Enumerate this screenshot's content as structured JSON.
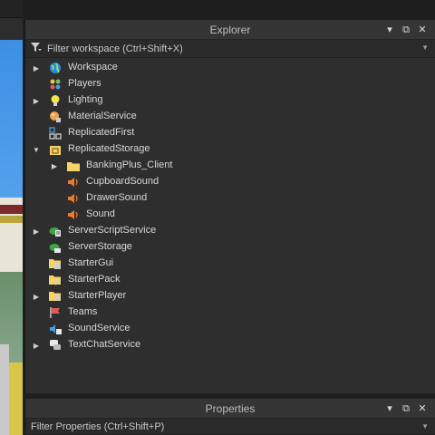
{
  "explorer": {
    "title": "Explorer",
    "filter_placeholder": "Filter workspace (Ctrl+Shift+X)",
    "items": [
      {
        "label": "Workspace",
        "level": 0,
        "arrow": "right",
        "icon": "globe-icon"
      },
      {
        "label": "Players",
        "level": 0,
        "arrow": "",
        "icon": "players-icon"
      },
      {
        "label": "Lighting",
        "level": 0,
        "arrow": "right",
        "icon": "lightbulb-icon"
      },
      {
        "label": "MaterialService",
        "level": 0,
        "arrow": "",
        "icon": "material-icon"
      },
      {
        "label": "ReplicatedFirst",
        "level": 0,
        "arrow": "",
        "icon": "replicated-first-icon"
      },
      {
        "label": "ReplicatedStorage",
        "level": 0,
        "arrow": "down",
        "icon": "replicated-storage-icon"
      },
      {
        "label": "BankingPlus_Client",
        "level": 1,
        "arrow": "right",
        "icon": "folder-icon"
      },
      {
        "label": "CupboardSound",
        "level": 1,
        "arrow": "",
        "icon": "speaker-icon"
      },
      {
        "label": "DrawerSound",
        "level": 1,
        "arrow": "",
        "icon": "speaker-icon"
      },
      {
        "label": "Sound",
        "level": 1,
        "arrow": "",
        "icon": "speaker-icon"
      },
      {
        "label": "ServerScriptService",
        "level": 0,
        "arrow": "right",
        "icon": "server-script-icon"
      },
      {
        "label": "ServerStorage",
        "level": 0,
        "arrow": "",
        "icon": "server-storage-icon"
      },
      {
        "label": "StarterGui",
        "level": 0,
        "arrow": "",
        "icon": "starter-gui-icon"
      },
      {
        "label": "StarterPack",
        "level": 0,
        "arrow": "",
        "icon": "starter-pack-icon"
      },
      {
        "label": "StarterPlayer",
        "level": 0,
        "arrow": "right",
        "icon": "starter-player-icon"
      },
      {
        "label": "Teams",
        "level": 0,
        "arrow": "",
        "icon": "teams-icon"
      },
      {
        "label": "SoundService",
        "level": 0,
        "arrow": "",
        "icon": "sound-service-icon"
      },
      {
        "label": "TextChatService",
        "level": 0,
        "arrow": "right",
        "icon": "text-chat-icon"
      }
    ]
  },
  "properties": {
    "title": "Properties",
    "filter_placeholder": "Filter Properties (Ctrl+Shift+P)"
  },
  "header_buttons": {
    "dropdown": "▾",
    "popout": "⧉",
    "close": "✕"
  },
  "colors": {
    "panel_bg": "#2e2e2e",
    "header_bg": "#353535",
    "folder": "#f3d36a",
    "speaker": "#e87a2a",
    "accent_blue": "#2a7fd4"
  }
}
